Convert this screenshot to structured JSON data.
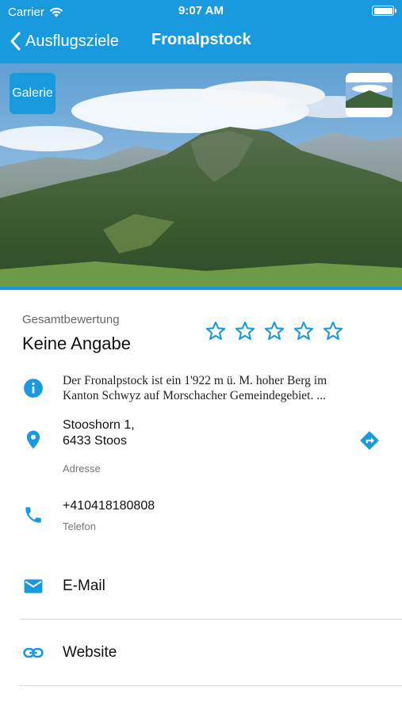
{
  "status_bar": {
    "carrier": "Carrier",
    "time": "9:07 AM"
  },
  "nav": {
    "back_label": "Ausflugsziele",
    "title": "Fronalpstock"
  },
  "hero": {
    "gallery_label": "Galerie"
  },
  "rating": {
    "label": "Gesamtbewertung",
    "value": "Keine Angabe",
    "stars_total": 5,
    "stars_filled": 0
  },
  "info": {
    "description": "Der Fronalpstock ist ein 1'922 m ü. M. hoher Berg im Kanton Schwyz auf Morschacher Gemeindegebiet. ..."
  },
  "address": {
    "line1": "Stooshorn 1,",
    "line2": "6433 Stoos",
    "caption": "Adresse"
  },
  "phone": {
    "number": "+410418180808",
    "caption": "Telefon"
  },
  "links": {
    "email_label": "E-Mail",
    "website_label": "Website"
  },
  "colors": {
    "accent": "#1a9ade",
    "text": "#111111",
    "caption": "#777777",
    "divider": "#d6d6d6"
  }
}
